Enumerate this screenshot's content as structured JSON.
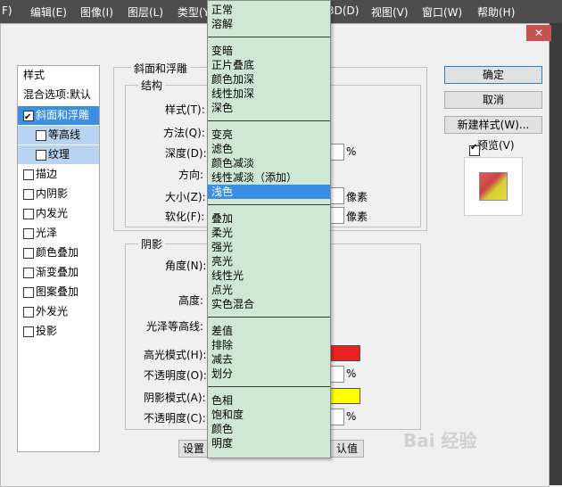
{
  "menubar": {
    "items": [
      "F)",
      "编辑(E)",
      "图像(I)",
      "图层(L)",
      "类型(Y",
      "3D(D)",
      "视图(V)",
      "窗口(W)",
      "帮助(H)"
    ]
  },
  "dialog": {
    "close": "✕",
    "styles_list": {
      "header": "样式",
      "blend_options": "混合选项:默认",
      "items": [
        "斜面和浮雕",
        "等高线",
        "纹理",
        "描边",
        "内阴影",
        "内发光",
        "光泽",
        "颜色叠加",
        "渐变叠加",
        "图案叠加",
        "外发光",
        "投影"
      ]
    },
    "bevel": {
      "group_title": "斜面和浮雕",
      "structure_title": "结构",
      "style_label": "样式(T):",
      "method_label": "方法(Q):",
      "depth_label": "深度(D):",
      "depth_unit": "%",
      "direction_label": "方向:",
      "size_label": "大小(Z):",
      "size_unit": "像素",
      "soften_label": "软化(F):",
      "soften_unit": "像素"
    },
    "shading": {
      "title": "阴影",
      "angle_label": "角度(N):",
      "altitude_label": "高度:",
      "gloss_contour_label": "光泽等高线:",
      "highlight_mode_label": "高光模式(H):",
      "highlight_color": "#e82222",
      "highlight_opacity_label": "不透明度(O):",
      "highlight_opacity_unit": "%",
      "shadow_mode_label": "阴影模式(A):",
      "shadow_color": "#ffff00",
      "shadow_opacity_label": "不透明度(C):",
      "shadow_opacity_unit": "%"
    },
    "buttons": {
      "ok": "确定",
      "cancel": "取消",
      "new_style": "新建样式(W)...",
      "preview": "预览(V)",
      "set_default": "设置",
      "reset_default": "认值"
    }
  },
  "dropdown": {
    "groups": [
      [
        "正常",
        "溶解"
      ],
      [
        "变暗",
        "正片叠底",
        "颜色加深",
        "线性加深",
        "深色"
      ],
      [
        "变亮",
        "滤色",
        "颜色减淡",
        "线性减淡（添加）",
        "浅色"
      ],
      [
        "叠加",
        "柔光",
        "强光",
        "亮光",
        "线性光",
        "点光",
        "实色混合"
      ],
      [
        "差值",
        "排除",
        "减去",
        "划分"
      ],
      [
        "色相",
        "饱和度",
        "颜色",
        "明度"
      ]
    ],
    "selected": "浅色"
  },
  "watermark": "Bai 经验"
}
